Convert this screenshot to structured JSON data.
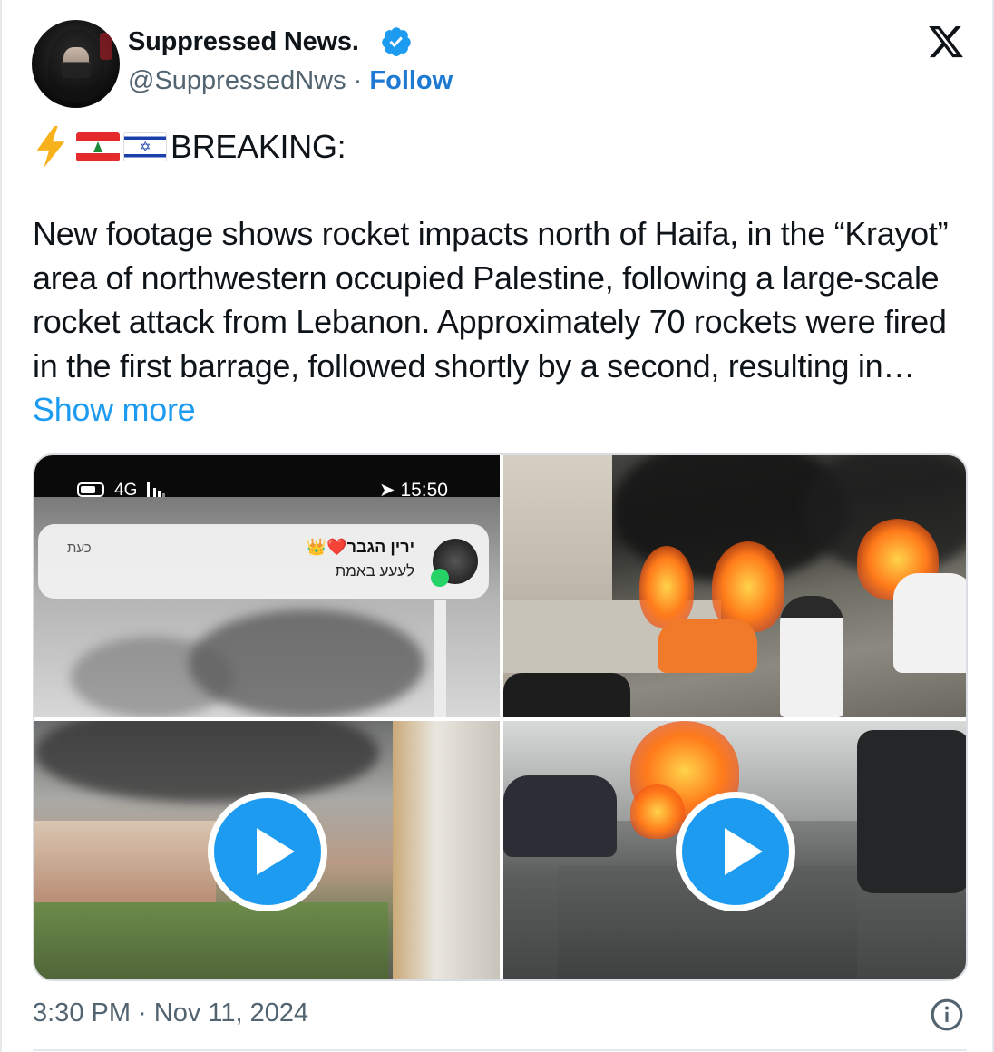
{
  "author": {
    "display_name": "Suppressed News.",
    "handle": "@SuppressedNws",
    "separator": " · ",
    "follow_label": "Follow",
    "verified": true,
    "avatar_icon": "hooded-figure-avatar"
  },
  "platform": {
    "logo": "x-logo"
  },
  "tweet": {
    "headline_icons": [
      "lightning-emoji",
      "lebanon-flag-emoji",
      "israel-flag-emoji"
    ],
    "headline": "BREAKING:",
    "body": "New footage shows rocket impacts north of Haifa, in the “Krayot” area of northwestern occupied Palestine, following a large-scale rocket attack from Lebanon. Approximately 70 rockets were fired in the first barrage, followed shortly by a second, resulting in… ",
    "show_more_label": "Show more"
  },
  "media": {
    "phone_screenshot": {
      "network": "4G",
      "clock": "15:50",
      "notification_time": "כעת",
      "notification_sender": "ירין הגבר❤️👑",
      "notification_message": "לעעע באמת"
    },
    "items": [
      {
        "type": "image",
        "description_icon": "phone-screenshot"
      },
      {
        "type": "image",
        "description_icon": "burning-cars-photo"
      },
      {
        "type": "video",
        "play_icon": "play-icon"
      },
      {
        "type": "video",
        "play_icon": "play-icon"
      }
    ]
  },
  "footer": {
    "timestamp": "3:30 PM · Nov 11, 2024",
    "info_icon": "info-icon"
  },
  "colors": {
    "link_blue": "#1d9bf0",
    "follow_blue": "#1d79d2",
    "muted_text": "#536471",
    "verified_blue": "#1d9bf0"
  }
}
